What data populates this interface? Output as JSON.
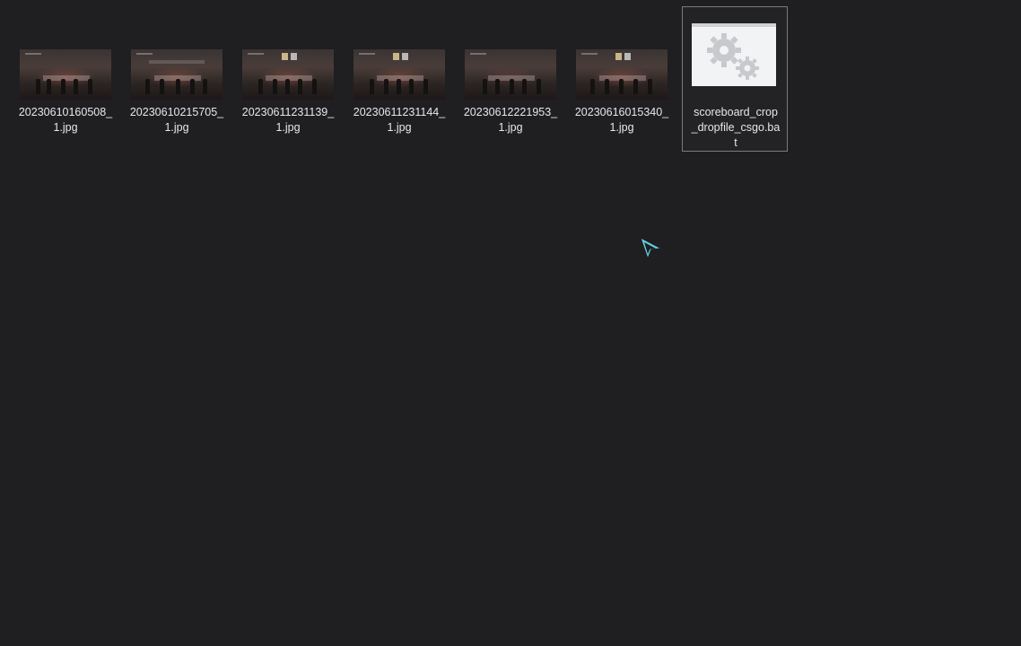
{
  "desktop": {
    "files": [
      {
        "name": "20230610160508_\n1.jpg",
        "type": "jpg",
        "icon": "image-thumbnail-icon"
      },
      {
        "name": "20230610215705_\n1.jpg",
        "type": "jpg",
        "icon": "image-thumbnail-icon"
      },
      {
        "name": "20230611231139_\n1.jpg",
        "type": "jpg",
        "icon": "image-thumbnail-icon"
      },
      {
        "name": "20230611231144_\n1.jpg",
        "type": "jpg",
        "icon": "image-thumbnail-icon"
      },
      {
        "name": "20230612221953_\n1.jpg",
        "type": "jpg",
        "icon": "image-thumbnail-icon"
      },
      {
        "name": "20230616015340_\n1.jpg",
        "type": "jpg",
        "icon": "image-thumbnail-icon"
      },
      {
        "name": "scoreboard_crop\n_dropfile_csgo.ba\nt",
        "type": "bat",
        "icon": "batch-file-gears-icon",
        "selected": true
      }
    ],
    "cursor_icon": "pointer-cursor-icon",
    "colors": {
      "background": "#1f1e21",
      "cursor": "#5fd0e6",
      "selection_border": "#7a7a7e"
    }
  }
}
